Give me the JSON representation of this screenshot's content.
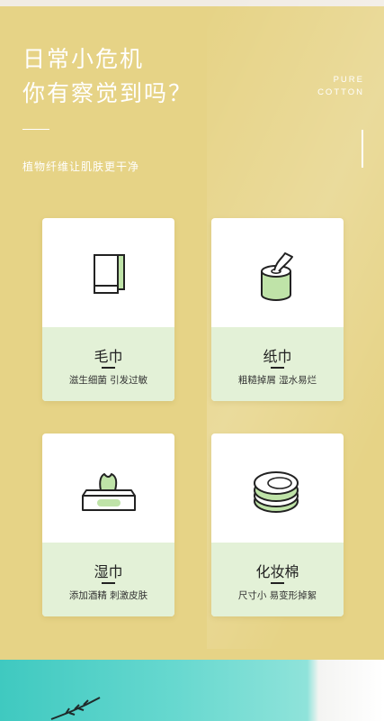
{
  "header": {
    "title_line1": "日常小危机",
    "title_line2": "你有察觉到吗？",
    "badge_line1": "PURE",
    "badge_line2": "COTTON",
    "subtitle": "植物纤维让肌肤更干净"
  },
  "cards": [
    {
      "name": "毛巾",
      "desc": "滋生细菌 引发过敏",
      "icon": "towel-icon"
    },
    {
      "name": "纸巾",
      "desc": "粗糙掉屑 湿水易烂",
      "icon": "tissue-roll-icon"
    },
    {
      "name": "湿巾",
      "desc": "添加酒精 刺激皮肤",
      "icon": "wet-wipes-box-icon"
    },
    {
      "name": "化妆棉",
      "desc": "尺寸小 易变形掉絮",
      "icon": "cotton-pads-icon"
    }
  ],
  "colors": {
    "background": "#e6d386",
    "card_lower": "#e3f1d7",
    "accent_green": "#bfe3a8",
    "bottom_teal": "#3fc9c0"
  }
}
